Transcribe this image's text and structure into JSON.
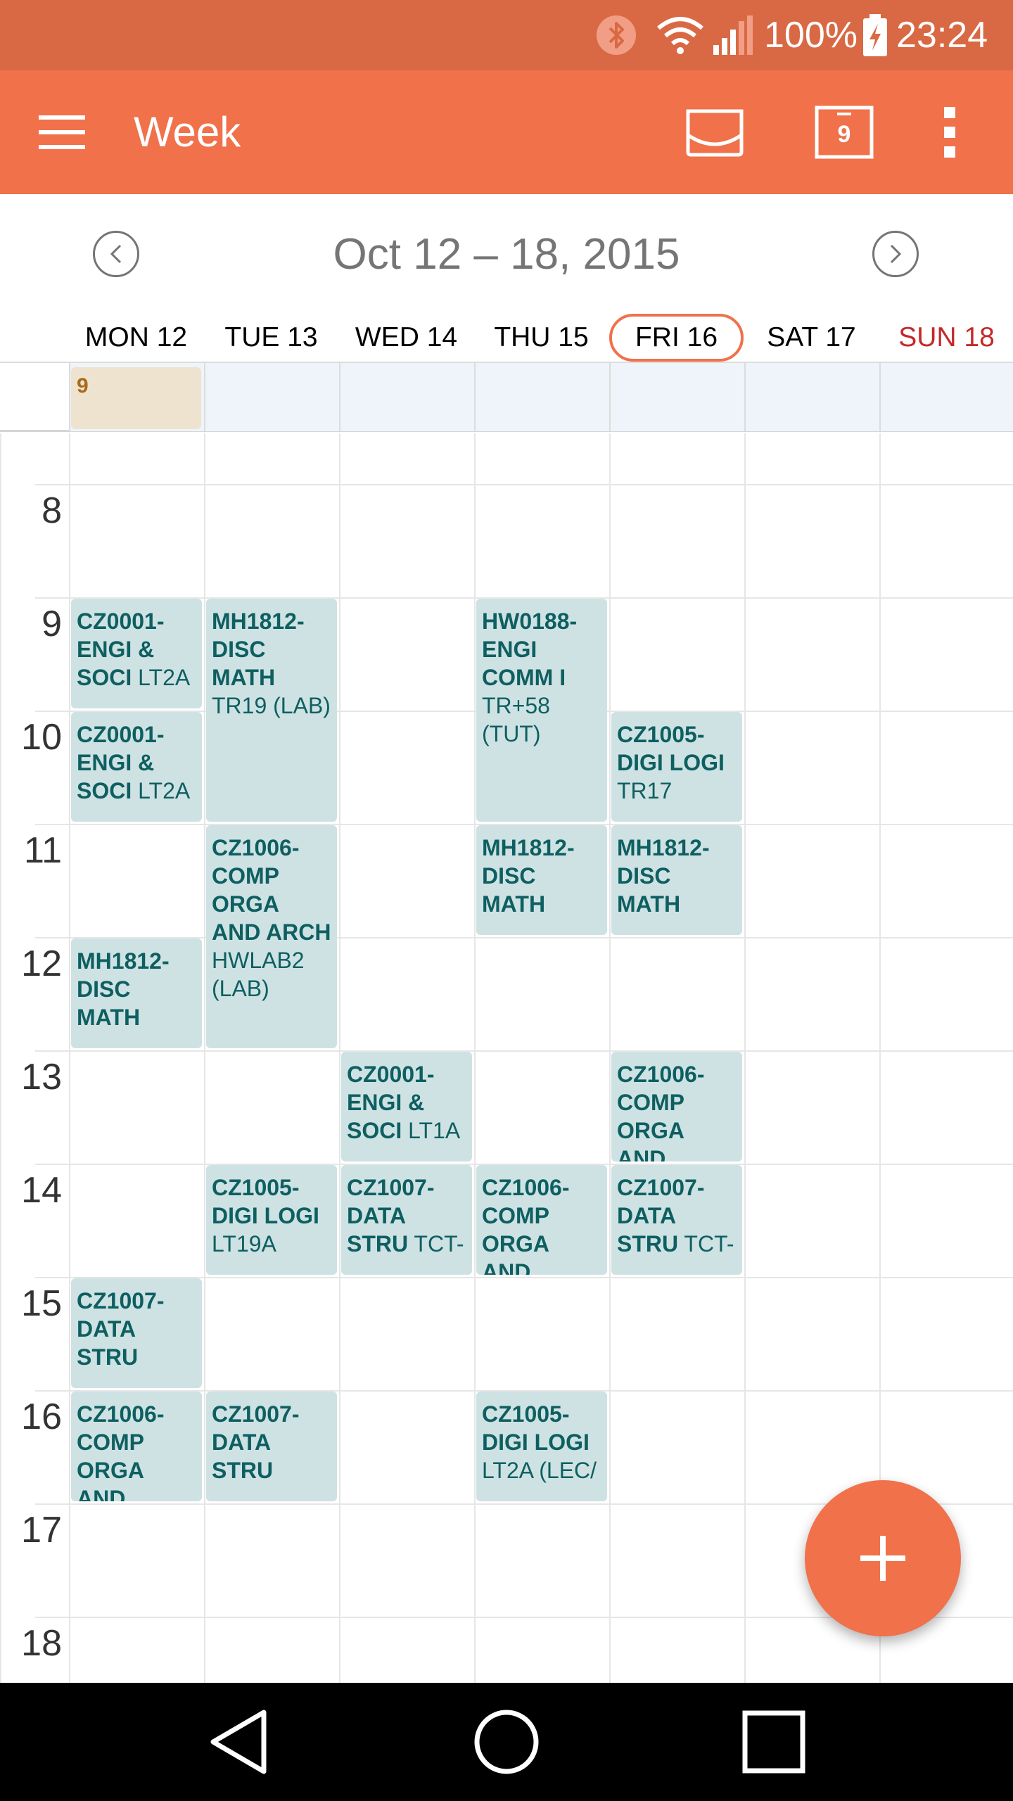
{
  "status_bar": {
    "battery_text": "100%",
    "time": "23:24",
    "icons": [
      "bluetooth-icon",
      "wifi-icon",
      "signal-icon",
      "battery-charging-icon"
    ]
  },
  "app_bar": {
    "title": "Week",
    "calendar_badge": "9",
    "icons": [
      "menu-icon",
      "inbox-icon",
      "today-icon",
      "overflow-icon"
    ],
    "color": "#F0714A"
  },
  "week_header": {
    "range": "Oct 12 – 18, 2015"
  },
  "days": [
    {
      "label": "MON 12",
      "today": false,
      "sunday": false
    },
    {
      "label": "TUE 13",
      "today": false,
      "sunday": false
    },
    {
      "label": "WED 14",
      "today": false,
      "sunday": false
    },
    {
      "label": "THU 15",
      "today": false,
      "sunday": false
    },
    {
      "label": "FRI 16",
      "today": true,
      "sunday": false
    },
    {
      "label": "SAT 17",
      "today": false,
      "sunday": false
    },
    {
      "label": "SUN 18",
      "today": false,
      "sunday": true
    }
  ],
  "all_day": {
    "day": 0,
    "label": "9"
  },
  "hours": [
    "8",
    "9",
    "10",
    "11",
    "12",
    "13",
    "14",
    "15",
    "16",
    "17",
    "18"
  ],
  "events": [
    {
      "day": 0,
      "start": 9,
      "end": 10,
      "code": "CZ0001-",
      "title": "ENGI & SOCI",
      "location": "LT2A"
    },
    {
      "day": 0,
      "start": 10,
      "end": 11,
      "code": "CZ0001-",
      "title": "ENGI & SOCI",
      "location": "LT2A"
    },
    {
      "day": 0,
      "start": 12,
      "end": 13,
      "code": "MH1812-",
      "title": "DISC MATH",
      "location": ""
    },
    {
      "day": 0,
      "start": 15,
      "end": 16,
      "code": "CZ1007-",
      "title": "DATA STRU",
      "location": ""
    },
    {
      "day": 0,
      "start": 16,
      "end": 17,
      "code": "CZ1006-",
      "title": "COMP ORGA AND",
      "location": ""
    },
    {
      "day": 1,
      "start": 9,
      "end": 11,
      "code": "MH1812-",
      "title": "DISC MATH",
      "location": "TR19 (LAB)"
    },
    {
      "day": 1,
      "start": 11,
      "end": 13,
      "code": "CZ1006-",
      "title": "COMP ORGA AND ARCH",
      "location": "HWLAB2 (LAB)"
    },
    {
      "day": 1,
      "start": 14,
      "end": 15,
      "code": "CZ1005-",
      "title": "DIGI LOGI",
      "location": "LT19A"
    },
    {
      "day": 1,
      "start": 16,
      "end": 17,
      "code": "CZ1007-",
      "title": "DATA STRU",
      "location": ""
    },
    {
      "day": 2,
      "start": 13,
      "end": 14,
      "code": "CZ0001-",
      "title": "ENGI & SOCI",
      "location": "LT1A"
    },
    {
      "day": 2,
      "start": 14,
      "end": 15,
      "code": "CZ1007-",
      "title": "DATA STRU",
      "location": "TCT-"
    },
    {
      "day": 3,
      "start": 9,
      "end": 11,
      "code": "HW0188-",
      "title": "ENGI COMM I",
      "location": "TR+58 (TUT)"
    },
    {
      "day": 3,
      "start": 11,
      "end": 12,
      "code": "MH1812-",
      "title": "DISC MATH",
      "location": ""
    },
    {
      "day": 3,
      "start": 14,
      "end": 15,
      "code": "CZ1006-",
      "title": "COMP ORGA AND",
      "location": ""
    },
    {
      "day": 3,
      "start": 16,
      "end": 17,
      "code": "CZ1005-",
      "title": "DIGI LOGI",
      "location": "LT2A (LEC/"
    },
    {
      "day": 4,
      "start": 10,
      "end": 11,
      "code": "CZ1005-",
      "title": "DIGI LOGI",
      "location": "TR17"
    },
    {
      "day": 4,
      "start": 11,
      "end": 12,
      "code": "MH1812-",
      "title": "DISC MATH",
      "location": ""
    },
    {
      "day": 4,
      "start": 13,
      "end": 14,
      "code": "CZ1006-",
      "title": "COMP ORGA AND",
      "location": ""
    },
    {
      "day": 4,
      "start": 14,
      "end": 15,
      "code": "CZ1007-",
      "title": "DATA STRU",
      "location": "TCT-"
    }
  ],
  "fab": {
    "icon": "plus-icon"
  },
  "nav_bar": {
    "icons": [
      "back-icon",
      "home-icon",
      "recents-icon"
    ]
  }
}
